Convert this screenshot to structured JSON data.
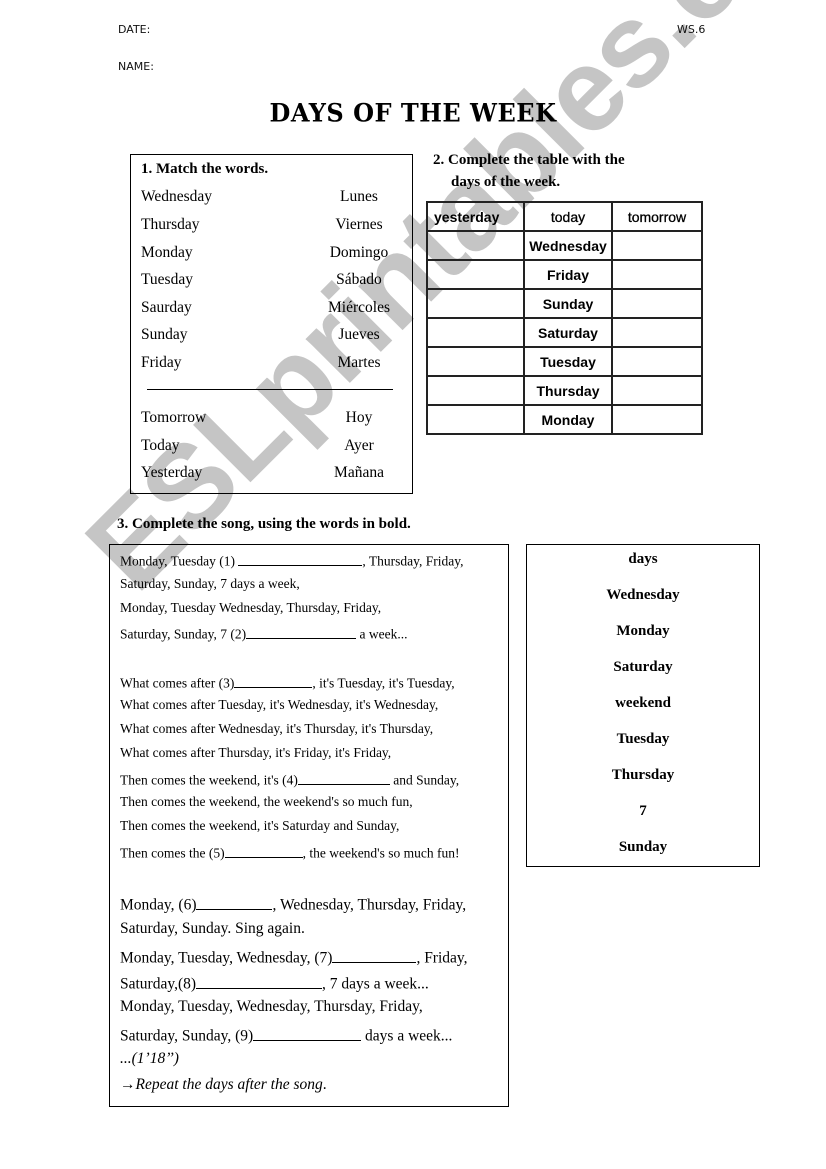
{
  "header": {
    "date_label": "DATE:",
    "worksheet_code": "WS.6",
    "name_label": "NAME:",
    "title": "DAYS OF THE WEEK"
  },
  "task1": {
    "heading": "1. Match the words.",
    "pairs": [
      {
        "en": "Wednesday",
        "es": "Lunes"
      },
      {
        "en": "Thursday",
        "es": "Viernes"
      },
      {
        "en": "Monday",
        "es": "Domingo"
      },
      {
        "en": "Tuesday",
        "es": "Sábado"
      },
      {
        "en": "Saurday",
        "es": "Miércoles"
      },
      {
        "en": "Sunday",
        "es": "Jueves"
      },
      {
        "en": "Friday",
        "es": "Martes"
      }
    ],
    "time_pairs": [
      {
        "en": "Tomorrow",
        "es": "Hoy"
      },
      {
        "en": "Today",
        "es": "Ayer"
      },
      {
        "en": "Yesterday",
        "es": "Mañana"
      }
    ]
  },
  "task2": {
    "heading_line1": "2. Complete the table with the",
    "heading_line2": "days of the week.",
    "columns": [
      "yesterday",
      "today",
      "tomorrow"
    ],
    "rows": [
      {
        "yesterday": "",
        "today": "Wednesday",
        "tomorrow": ""
      },
      {
        "yesterday": "",
        "today": "Friday",
        "tomorrow": ""
      },
      {
        "yesterday": "",
        "today": "Sunday",
        "tomorrow": ""
      },
      {
        "yesterday": "",
        "today": "Saturday",
        "tomorrow": ""
      },
      {
        "yesterday": "",
        "today": "Tuesday",
        "tomorrow": ""
      },
      {
        "yesterday": "",
        "today": "Thursday",
        "tomorrow": ""
      },
      {
        "yesterday": "",
        "today": "Monday",
        "tomorrow": ""
      }
    ]
  },
  "task3": {
    "heading": "3. Complete the song, using the words in bold.",
    "song": {
      "l1a": "Monday, Tuesday (1) ",
      "l1b": ", Thursday, Friday,",
      "l2": "Saturday, Sunday, 7 days a week,",
      "l3": "Monday, Tuesday Wednesday, Thursday, Friday,",
      "l4a": "Saturday, Sunday, 7 (2)",
      "l4b": " a week...",
      "l5a": "What comes after  (3)",
      "l5b": ", it's Tuesday, it's Tuesday,",
      "l6": "What comes after Tuesday, it's Wednesday, it's Wednesday,",
      "l7": "What comes after Wednesday, it's Thursday, it's Thursday,",
      "l8": "What comes after Thursday, it's Friday, it's Friday,",
      "l9a": "Then comes the weekend, it's (4)",
      "l9b": " and Sunday,",
      "l10": "Then comes the weekend, the weekend's so much fun,",
      "l11": "Then comes the weekend, it's Saturday and Sunday,",
      "l12a": "Then comes the (5)",
      "l12b": ", the weekend's so much fun!",
      "l13a": "Monday, (6)",
      "l13b": ", Wednesday, Thursday, Friday,",
      "l14": "Saturday, Sunday. Sing again.",
      "l15a": "Monday, Tuesday, Wednesday, (7)",
      "l15b": ", Friday,",
      "l16a": "Saturday,(8)",
      "l16b": ", 7 days a week...",
      "l17": "Monday, Tuesday, Wednesday, Thursday, Friday,",
      "l18a": "Saturday, Sunday, (9)",
      "l18b": " days a week...",
      "duration": "...(1’18’’)",
      "arrow": "→",
      "instruction": "Repeat the days after the song",
      "instruction_end": "."
    },
    "word_bank": [
      "days",
      "Wednesday",
      "Monday",
      "Saturday",
      "weekend",
      "Tuesday",
      "Thursday",
      "7",
      "Sunday"
    ]
  },
  "watermark": "ESLprintables.com"
}
